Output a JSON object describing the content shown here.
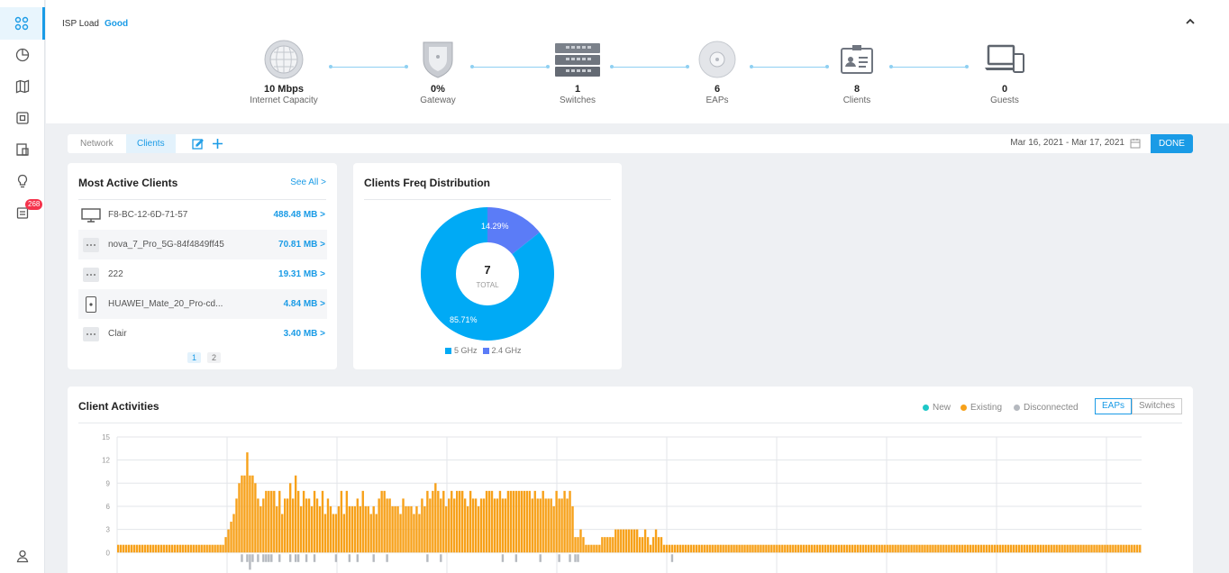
{
  "sidebar": {
    "items": [
      {
        "name": "dashboard-icon",
        "active": true
      },
      {
        "name": "statistics-icon"
      },
      {
        "name": "map-icon"
      },
      {
        "name": "devices-icon"
      },
      {
        "name": "clients-icon"
      },
      {
        "name": "insight-icon"
      },
      {
        "name": "log-icon",
        "badge": "268"
      }
    ],
    "bottom": {
      "name": "account-icon"
    }
  },
  "topology": {
    "isp_label": "ISP Load",
    "isp_status": "Good",
    "nodes": [
      {
        "value": "10 Mbps",
        "label": "Internet Capacity",
        "icon": "globe-icon"
      },
      {
        "value": "0%",
        "label": "Gateway",
        "icon": "gateway-shield-icon"
      },
      {
        "value": "1",
        "label": "Switches",
        "icon": "switch-icon"
      },
      {
        "value": "6",
        "label": "EAPs",
        "icon": "access-point-icon"
      },
      {
        "value": "8",
        "label": "Clients",
        "icon": "client-id-card-icon"
      },
      {
        "value": "0",
        "label": "Guests",
        "icon": "laptop-phone-icon"
      }
    ]
  },
  "toolbar": {
    "tabs": [
      "Network",
      "Clients"
    ],
    "active_tab": "Clients",
    "date_range": "Mar 16, 2021 - Mar 17, 2021",
    "done_label": "DONE"
  },
  "most_active": {
    "title": "Most Active Clients",
    "see_all": "See All >",
    "clients": [
      {
        "name": "F8-BC-12-6D-71-57",
        "usage": "488.48 MB >",
        "icon": "monitor-icon"
      },
      {
        "name": "nova_7_Pro_5G-84f4849ff45",
        "usage": "70.81 MB >",
        "icon": "more-dots-icon"
      },
      {
        "name": "222",
        "usage": "19.31 MB >",
        "icon": "more-dots-icon"
      },
      {
        "name": "HUAWEI_Mate_20_Pro-cd...",
        "usage": "4.84 MB >",
        "icon": "phone-icon"
      },
      {
        "name": "Clair",
        "usage": "3.40 MB >",
        "icon": "more-dots-icon"
      }
    ],
    "pages": [
      "1",
      "2"
    ]
  },
  "freq": {
    "title": "Clients Freq Distribution",
    "total": "7",
    "total_label": "TOTAL",
    "slices": [
      {
        "name": "5 GHz",
        "pct_label": "85.71%",
        "value": 85.71,
        "color": "#00aaf5"
      },
      {
        "name": "2.4 GHz",
        "pct_label": "14.29%",
        "value": 14.29,
        "color": "#5b7cf7"
      }
    ]
  },
  "activities": {
    "title": "Client Activities",
    "legend": [
      {
        "label": "New",
        "color": "#1ec7c7"
      },
      {
        "label": "Existing",
        "color": "#f7a11a"
      },
      {
        "label": "Disconnected",
        "color": "#b5b9bf"
      }
    ],
    "segments": [
      "EAPs",
      "Switches"
    ],
    "active_segment": "EAPs"
  },
  "chart_data": {
    "type": "bar",
    "title": "Client Activities",
    "y_ticks": [
      "15",
      "12",
      "9",
      "6",
      "3",
      "0",
      "3"
    ],
    "ylim": [
      -3,
      15
    ],
    "series": [
      {
        "name": "Existing",
        "color": "#f7a11a",
        "values": [
          1,
          1,
          1,
          1,
          1,
          1,
          1,
          1,
          1,
          1,
          1,
          1,
          1,
          1,
          1,
          1,
          1,
          1,
          1,
          1,
          1,
          1,
          1,
          1,
          1,
          1,
          1,
          1,
          1,
          1,
          1,
          1,
          1,
          1,
          1,
          1,
          1,
          1,
          1,
          1,
          2,
          3,
          4,
          5,
          7,
          9,
          10,
          10,
          13,
          10,
          10,
          9,
          7,
          6,
          7,
          8,
          8,
          8,
          8,
          6,
          8,
          5,
          7,
          7,
          9,
          7,
          10,
          8,
          6,
          8,
          7,
          7,
          6,
          8,
          7,
          6,
          8,
          5,
          7,
          6,
          5,
          5,
          6,
          8,
          5,
          8,
          6,
          6,
          6,
          7,
          6,
          8,
          6,
          6,
          5,
          6,
          5,
          7,
          8,
          8,
          7,
          7,
          6,
          6,
          6,
          5,
          7,
          6,
          6,
          6,
          5,
          6,
          5,
          7,
          6,
          8,
          7,
          8,
          9,
          8,
          7,
          8,
          6,
          7,
          8,
          7,
          8,
          8,
          8,
          7,
          6,
          8,
          7,
          7,
          6,
          7,
          7,
          8,
          8,
          8,
          7,
          7,
          8,
          7,
          7,
          8,
          8,
          8,
          8,
          8,
          8,
          8,
          8,
          8,
          7,
          8,
          7,
          7,
          8,
          7,
          7,
          7,
          6,
          8,
          7,
          7,
          8,
          7,
          8,
          6,
          2,
          2,
          3,
          2,
          1,
          1,
          1,
          1,
          1,
          1,
          2,
          2,
          2,
          2,
          2,
          3,
          3,
          3,
          3,
          3,
          3,
          3,
          3,
          3,
          2,
          2,
          3,
          2,
          1,
          2,
          3,
          2,
          2,
          1,
          1,
          1,
          1,
          1,
          1,
          1,
          1,
          1,
          1,
          1,
          1,
          1,
          1,
          1,
          1,
          1,
          1,
          1,
          1,
          1,
          1,
          1,
          1,
          1,
          1,
          1,
          1,
          1,
          1,
          1,
          1,
          1,
          1,
          1,
          1,
          1,
          1,
          1,
          1,
          1,
          1,
          1,
          1,
          1,
          1,
          1,
          1,
          1,
          1,
          1,
          1,
          1,
          1,
          1,
          1,
          1,
          1,
          1,
          1,
          1,
          1,
          1,
          1,
          1,
          1,
          1,
          1,
          1,
          1,
          1,
          1,
          1,
          1,
          1,
          1,
          1,
          1,
          1,
          1,
          1,
          1,
          1,
          1,
          1,
          1,
          1,
          1,
          1,
          1,
          1,
          1,
          1,
          1,
          1,
          1,
          1,
          1,
          1,
          1,
          1,
          1,
          1,
          1,
          1,
          1,
          1,
          1,
          1,
          1,
          1,
          1,
          1,
          1,
          1,
          1,
          1,
          1,
          1,
          1,
          1,
          1,
          1,
          1,
          1,
          1,
          1,
          1,
          1,
          1,
          1,
          1,
          1,
          1,
          1,
          1,
          1,
          1,
          1,
          1,
          1,
          1,
          1,
          1,
          1,
          1,
          1,
          1,
          1,
          1,
          1,
          1,
          1,
          1,
          1,
          1,
          1,
          1,
          1,
          1,
          1,
          1,
          1,
          1,
          1,
          1,
          1,
          1,
          1,
          1,
          1,
          1,
          1,
          1,
          1,
          1,
          1,
          1
        ]
      },
      {
        "name": "Disconnected",
        "color": "#b5b9bf",
        "values": [
          0,
          0,
          0,
          0,
          0,
          0,
          0,
          0,
          0,
          0,
          0,
          0,
          0,
          0,
          0,
          0,
          0,
          0,
          0,
          0,
          0,
          0,
          0,
          0,
          0,
          0,
          0,
          0,
          0,
          0,
          0,
          0,
          0,
          0,
          0,
          0,
          0,
          0,
          0,
          0,
          0,
          0,
          0,
          0,
          0,
          0,
          -1,
          0,
          -1,
          -2,
          -1,
          0,
          -1,
          0,
          -1,
          -1,
          -1,
          -1,
          0,
          0,
          -1,
          0,
          0,
          0,
          -1,
          0,
          -1,
          -1,
          0,
          0,
          -1,
          0,
          0,
          -1,
          0,
          0,
          0,
          0,
          0,
          0,
          0,
          -1,
          0,
          0,
          0,
          0,
          -1,
          0,
          0,
          -1,
          0,
          0,
          0,
          0,
          0,
          -1,
          0,
          0,
          0,
          0,
          -1,
          0,
          0,
          0,
          0,
          0,
          0,
          0,
          0,
          0,
          0,
          0,
          0,
          0,
          0,
          -1,
          0,
          0,
          0,
          0,
          -1,
          0,
          0,
          0,
          0,
          0,
          0,
          0,
          0,
          0,
          0,
          0,
          0,
          0,
          0,
          0,
          0,
          0,
          0,
          0,
          0,
          0,
          0,
          -1,
          0,
          0,
          0,
          0,
          -1,
          0,
          0,
          0,
          0,
          0,
          0,
          0,
          0,
          -1,
          0,
          0,
          0,
          0,
          0,
          0,
          -1,
          0,
          0,
          0,
          -1,
          0,
          -1,
          -1,
          0,
          0,
          0,
          0,
          0,
          0,
          0,
          0,
          0,
          0,
          0,
          0,
          0,
          0,
          0,
          0,
          0,
          0,
          0,
          0,
          0,
          0,
          0,
          0,
          0,
          0,
          0,
          0,
          0,
          0,
          0,
          0,
          0,
          0,
          -1,
          0,
          0,
          0,
          0,
          0,
          0,
          0,
          0,
          0,
          0,
          0,
          0,
          0,
          0,
          0,
          0,
          0,
          0,
          0,
          0,
          0,
          0,
          0,
          0,
          0,
          0,
          0,
          0,
          0,
          0,
          0,
          0,
          0,
          0,
          0,
          0,
          0,
          0,
          0,
          0,
          0,
          0,
          0,
          0,
          0,
          0,
          0,
          0,
          0,
          0,
          0,
          0,
          0,
          0,
          0,
          0,
          0,
          0,
          0,
          0,
          0,
          0,
          0,
          0,
          0,
          0,
          0,
          0,
          0,
          0,
          0,
          0,
          0,
          0,
          0,
          0,
          0,
          0,
          0,
          0,
          0,
          0,
          0,
          0,
          0,
          0,
          0,
          0,
          0,
          0,
          0,
          0,
          0,
          0,
          0,
          0,
          0,
          0,
          0,
          0,
          0,
          0,
          0,
          0,
          0,
          0,
          0,
          0,
          0,
          0,
          0,
          0,
          0,
          0,
          0,
          0,
          0,
          0,
          0,
          0,
          0,
          0,
          0,
          0,
          0,
          0,
          0,
          0,
          0,
          0,
          0,
          0,
          0,
          0,
          0,
          0,
          0,
          0,
          0,
          0,
          0,
          0,
          0,
          0,
          0,
          0,
          0,
          0,
          0,
          0,
          0,
          0,
          0,
          0,
          0,
          0,
          0,
          0,
          0
        ]
      }
    ]
  }
}
